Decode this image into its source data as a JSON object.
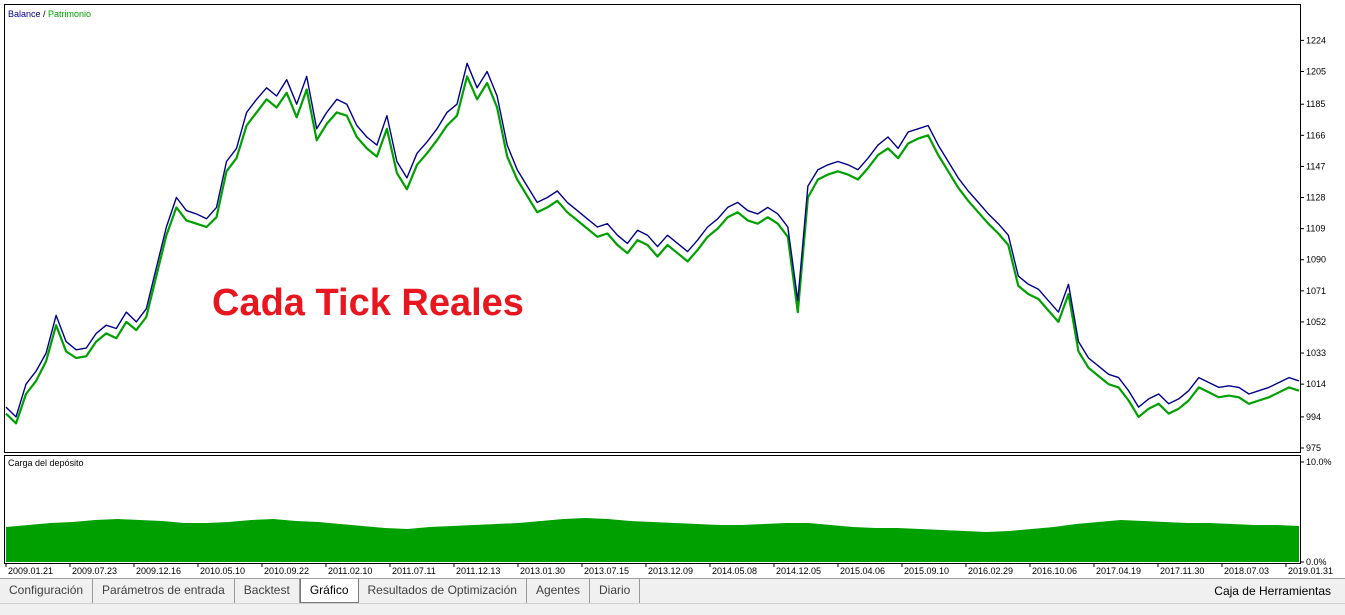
{
  "overlay_text": "Cada Tick Reales",
  "legend": {
    "balance": "Balance",
    "separator": " / ",
    "equity": "Patrimonio"
  },
  "sub_title": "Carga del depósito",
  "colors": {
    "balance": "#00008b",
    "equity": "#00a000",
    "load": "#00a000",
    "overlay": "#e8161e"
  },
  "chart_data": {
    "type": "line",
    "series": [
      {
        "name": "Balance",
        "values": [
          1000,
          994,
          1014,
          1022,
          1033,
          1056,
          1040,
          1035,
          1036,
          1045,
          1050,
          1048,
          1058,
          1052,
          1060,
          1085,
          1110,
          1128,
          1120,
          1118,
          1115,
          1122,
          1150,
          1158,
          1180,
          1188,
          1195,
          1190,
          1200,
          1185,
          1202,
          1170,
          1180,
          1188,
          1185,
          1172,
          1165,
          1160,
          1178,
          1150,
          1140,
          1155,
          1162,
          1170,
          1180,
          1185,
          1210,
          1195,
          1205,
          1190,
          1160,
          1145,
          1135,
          1125,
          1128,
          1132,
          1125,
          1120,
          1115,
          1110,
          1112,
          1105,
          1100,
          1108,
          1105,
          1098,
          1105,
          1100,
          1095,
          1102,
          1110,
          1115,
          1122,
          1125,
          1120,
          1118,
          1122,
          1118,
          1110,
          1065,
          1135,
          1145,
          1148,
          1150,
          1148,
          1145,
          1152,
          1160,
          1165,
          1158,
          1168,
          1170,
          1172,
          1160,
          1150,
          1140,
          1132,
          1125,
          1118,
          1112,
          1105,
          1080,
          1075,
          1072,
          1065,
          1058,
          1075,
          1040,
          1030,
          1025,
          1020,
          1018,
          1010,
          1000,
          1005,
          1008,
          1002,
          1005,
          1010,
          1018,
          1015,
          1012,
          1013,
          1012,
          1008,
          1010,
          1012,
          1015,
          1018,
          1016
        ]
      },
      {
        "name": "Patrimonio",
        "values": [
          996,
          990,
          1008,
          1016,
          1028,
          1050,
          1034,
          1030,
          1031,
          1040,
          1045,
          1042,
          1052,
          1047,
          1055,
          1080,
          1105,
          1122,
          1114,
          1112,
          1110,
          1116,
          1144,
          1152,
          1172,
          1180,
          1188,
          1183,
          1192,
          1177,
          1194,
          1163,
          1173,
          1180,
          1178,
          1165,
          1158,
          1153,
          1170,
          1143,
          1133,
          1148,
          1155,
          1163,
          1172,
          1178,
          1202,
          1188,
          1198,
          1183,
          1153,
          1139,
          1129,
          1119,
          1122,
          1126,
          1119,
          1114,
          1109,
          1104,
          1106,
          1099,
          1094,
          1102,
          1099,
          1092,
          1099,
          1094,
          1089,
          1096,
          1104,
          1109,
          1116,
          1119,
          1114,
          1112,
          1116,
          1112,
          1104,
          1058,
          1128,
          1139,
          1142,
          1144,
          1142,
          1139,
          1146,
          1154,
          1158,
          1152,
          1161,
          1164,
          1166,
          1154,
          1144,
          1134,
          1126,
          1119,
          1112,
          1106,
          1099,
          1074,
          1069,
          1066,
          1059,
          1052,
          1069,
          1034,
          1024,
          1019,
          1014,
          1012,
          1004,
          994,
          999,
          1002,
          996,
          999,
          1004,
          1012,
          1009,
          1006,
          1007,
          1006,
          1002,
          1004,
          1006,
          1009,
          1012,
          1010
        ]
      }
    ],
    "y_ticks": [
      "1224",
      "1205",
      "1185",
      "1166",
      "1147",
      "1128",
      "1109",
      "1090",
      "1071",
      "1052",
      "1033",
      "1014",
      "994",
      "975"
    ],
    "ylim": [
      975,
      1234
    ],
    "x_ticks": [
      "2009.01.21",
      "2009.07.23",
      "2009.12.16",
      "2010.05.10",
      "2010.09.22",
      "2011.02.10",
      "2011.07.11",
      "2011.12.13",
      "2013.01.30",
      "2013.07.15",
      "2013.12.09",
      "2014.05.08",
      "2014.12.05",
      "2015.04.06",
      "2015.09.10",
      "2016.02.29",
      "2016.10.06",
      "2017.04.19",
      "2017.11.30",
      "2018.07.03",
      "2019.01.31"
    ],
    "load": {
      "y_ticks": [
        "10.0%",
        "0.0%"
      ],
      "ylim": [
        0,
        10
      ],
      "values": [
        3.5,
        3.7,
        3.9,
        4.0,
        4.2,
        4.3,
        4.2,
        4.1,
        3.9,
        3.9,
        4.0,
        4.2,
        4.3,
        4.1,
        4.0,
        3.8,
        3.6,
        3.4,
        3.3,
        3.5,
        3.6,
        3.7,
        3.8,
        3.9,
        4.1,
        4.3,
        4.4,
        4.3,
        4.1,
        4.0,
        3.9,
        3.8,
        3.7,
        3.7,
        3.8,
        3.9,
        3.9,
        3.7,
        3.5,
        3.4,
        3.4,
        3.3,
        3.2,
        3.1,
        3.0,
        3.1,
        3.3,
        3.5,
        3.8,
        4.0,
        4.2,
        4.1,
        4.0,
        3.9,
        3.9,
        3.8,
        3.7,
        3.7,
        3.6
      ]
    }
  },
  "tabs": [
    {
      "label": "Configuración",
      "active": false
    },
    {
      "label": "Parámetros de entrada",
      "active": false
    },
    {
      "label": "Backtest",
      "active": false
    },
    {
      "label": "Gráfico",
      "active": true
    },
    {
      "label": "Resultados de Optimización",
      "active": false
    },
    {
      "label": "Agentes",
      "active": false
    },
    {
      "label": "Diario",
      "active": false
    }
  ],
  "toolbox_label": "Caja de Herramientas"
}
